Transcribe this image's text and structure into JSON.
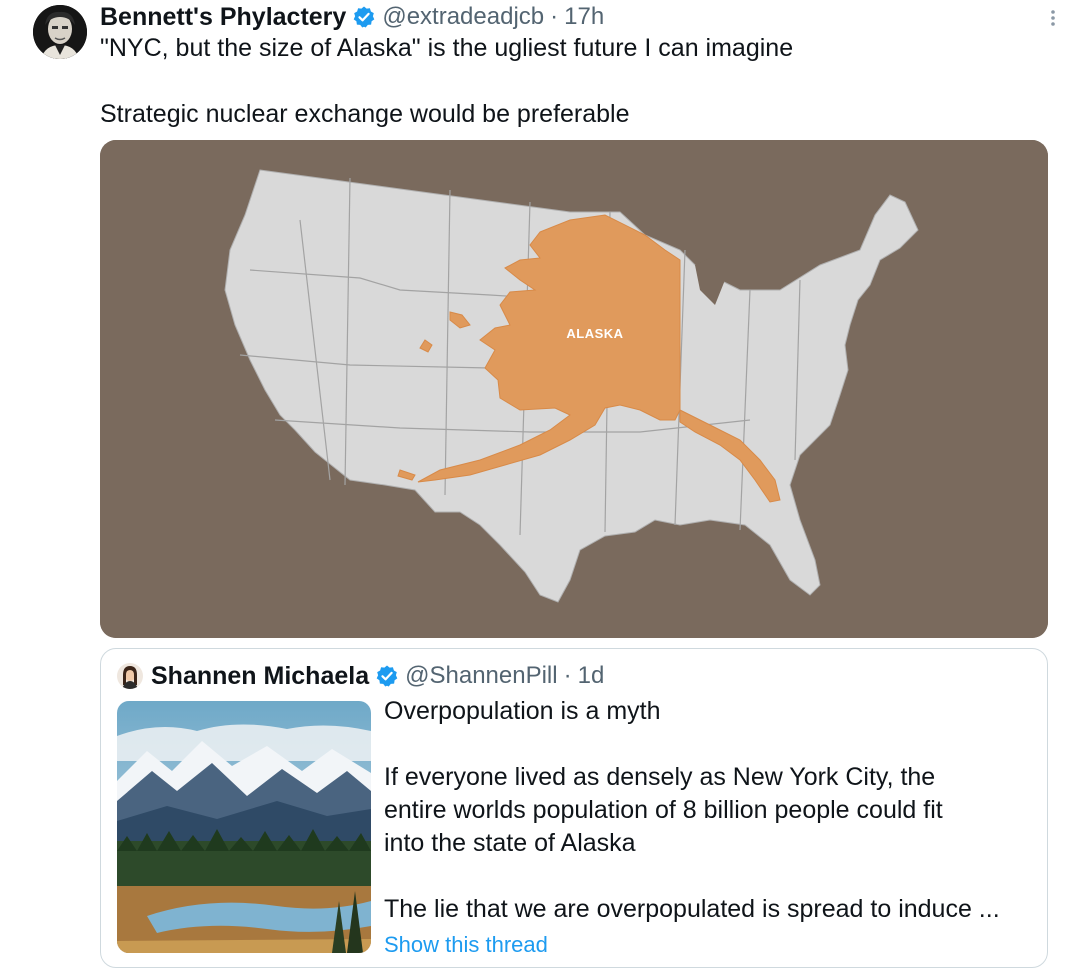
{
  "post": {
    "author_name": "Bennett's Phylactery",
    "handle": "@extradeadjcb",
    "separator": "·",
    "time": "17h",
    "verified": true,
    "avatar_icon": "profile-avatar-icon",
    "more_icon": "more-options-icon",
    "text_lines": [
      "\"NYC, but the size of Alaska\" is the ugliest future I can imagine",
      "Strategic nuclear exchange would be preferable"
    ],
    "media": {
      "map_label": "ALASKA",
      "colors": {
        "background": "#7a6a5d",
        "land": "#d9d9d9",
        "overlay": "#e09a5c",
        "borders": "#9a9a9a"
      }
    }
  },
  "quoted": {
    "author_name": "Shannen Michaela",
    "handle": "@ShannenPill",
    "separator": "·",
    "time": "1d",
    "verified": true,
    "text_lines": [
      "Overpopulation is a myth",
      "If everyone lived as densely as New York City, the",
      "entire worlds population of 8 billion people could fit",
      "into the state of Alaska",
      "The lie that we are overpopulated is spread to induce ..."
    ],
    "show_thread": "Show this thread"
  },
  "colors": {
    "accent": "#1d9bf0",
    "secondary_text": "#536471",
    "primary_text": "#0f1419"
  }
}
